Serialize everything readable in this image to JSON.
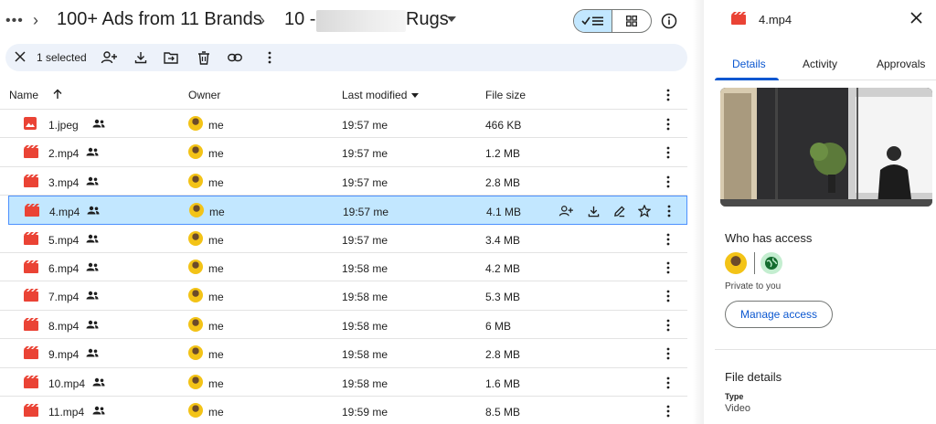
{
  "breadcrumb": {
    "more": "•••",
    "separator": "›",
    "items": [
      "100+ Ads from 11 Brands",
      "10 -",
      "Rugs"
    ]
  },
  "selection_bar": {
    "count_label": "1 selected"
  },
  "table": {
    "headers": {
      "name": "Name",
      "owner": "Owner",
      "modified": "Last modified",
      "size": "File size"
    },
    "rows": [
      {
        "name": "1.jpeg",
        "type": "image",
        "owner": "me",
        "modified": "19:57 me",
        "size": "466 KB"
      },
      {
        "name": "2.mp4",
        "type": "video",
        "owner": "me",
        "modified": "19:57 me",
        "size": "1.2 MB"
      },
      {
        "name": "3.mp4",
        "type": "video",
        "owner": "me",
        "modified": "19:57 me",
        "size": "2.8 MB"
      },
      {
        "name": "4.mp4",
        "type": "video",
        "owner": "me",
        "modified": "19:57 me",
        "size": "4.1 MB",
        "selected": true
      },
      {
        "name": "5.mp4",
        "type": "video",
        "owner": "me",
        "modified": "19:57 me",
        "size": "3.4 MB"
      },
      {
        "name": "6.mp4",
        "type": "video",
        "owner": "me",
        "modified": "19:58 me",
        "size": "4.2 MB"
      },
      {
        "name": "7.mp4",
        "type": "video",
        "owner": "me",
        "modified": "19:58 me",
        "size": "5.3 MB"
      },
      {
        "name": "8.mp4",
        "type": "video",
        "owner": "me",
        "modified": "19:58 me",
        "size": "6 MB"
      },
      {
        "name": "9.mp4",
        "type": "video",
        "owner": "me",
        "modified": "19:58 me",
        "size": "2.8 MB"
      },
      {
        "name": "10.mp4",
        "type": "video",
        "owner": "me",
        "modified": "19:58 me",
        "size": "1.6 MB"
      },
      {
        "name": "11.mp4",
        "type": "video",
        "owner": "me",
        "modified": "19:59 me",
        "size": "8.5 MB"
      }
    ]
  },
  "panel": {
    "title": "4.mp4",
    "tabs": [
      "Details",
      "Activity",
      "Approvals"
    ],
    "who_has_access": "Who has access",
    "private_text": "Private to you",
    "manage_access": "Manage access",
    "file_details": "File details",
    "type_label": "Type",
    "type_value": "Video"
  },
  "colors": {
    "accent": "#0b57d0",
    "selected_bg": "#c2e7ff",
    "file_red": "#ea4335",
    "toolbar_bg": "#edf2fa"
  }
}
